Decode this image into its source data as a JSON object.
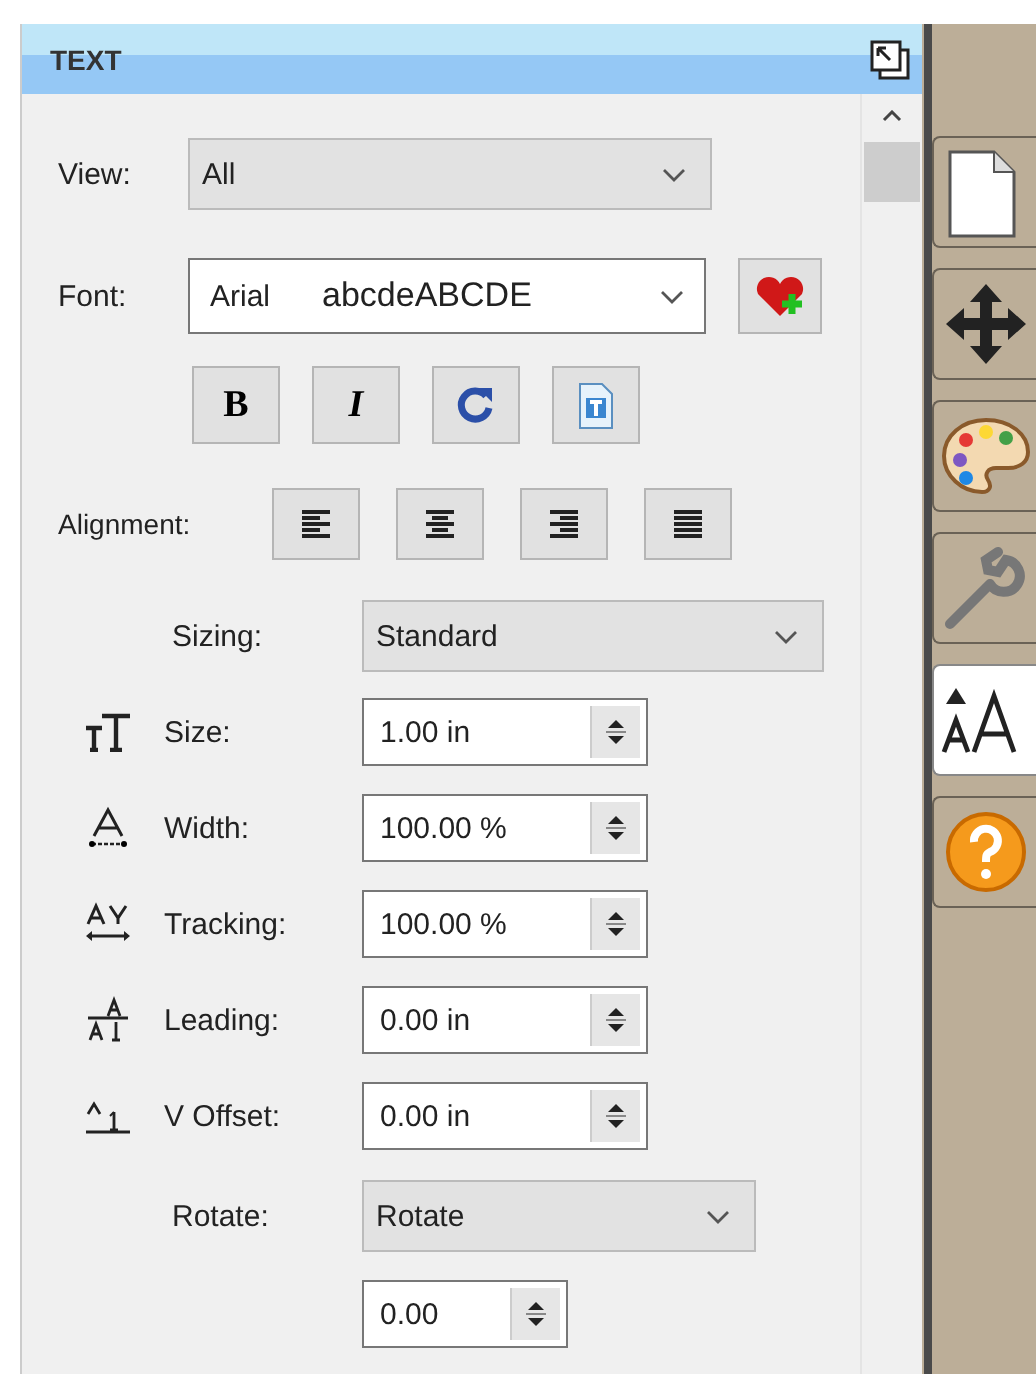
{
  "panel": {
    "title": "TEXT"
  },
  "view": {
    "label": "View:",
    "value": "All"
  },
  "font": {
    "label": "Font:",
    "name": "Arial",
    "sample": "abcdeABCDE"
  },
  "style_buttons": [
    {
      "kind": "bold",
      "glyph": "B"
    },
    {
      "kind": "italic",
      "glyph": "I"
    },
    {
      "kind": "refresh"
    },
    {
      "kind": "text-frame"
    }
  ],
  "alignment": {
    "label": "Alignment:",
    "buttons": [
      {
        "kind": "left"
      },
      {
        "kind": "center"
      },
      {
        "kind": "right"
      },
      {
        "kind": "justify"
      }
    ]
  },
  "sizing": {
    "label": "Sizing:",
    "value": "Standard"
  },
  "spin_fields": [
    {
      "kind": "size",
      "label": "Size:",
      "value": "1.00 in"
    },
    {
      "kind": "width",
      "label": "Width:",
      "value": "100.00 %"
    },
    {
      "kind": "tracking",
      "label": "Tracking:",
      "value": "100.00 %"
    },
    {
      "kind": "leading",
      "label": "Leading:",
      "value": "0.00 in"
    },
    {
      "kind": "offset",
      "label": "V Offset:",
      "value": "0.00 in"
    }
  ],
  "rotate": {
    "label": "Rotate:",
    "value": "Rotate",
    "angle": "0.00"
  },
  "side_tabs": [
    {
      "kind": "page",
      "selected": false
    },
    {
      "kind": "move",
      "selected": false
    },
    {
      "kind": "palette",
      "selected": false
    },
    {
      "kind": "wrench",
      "selected": false
    },
    {
      "kind": "text",
      "selected": true
    },
    {
      "kind": "help",
      "selected": false
    }
  ]
}
